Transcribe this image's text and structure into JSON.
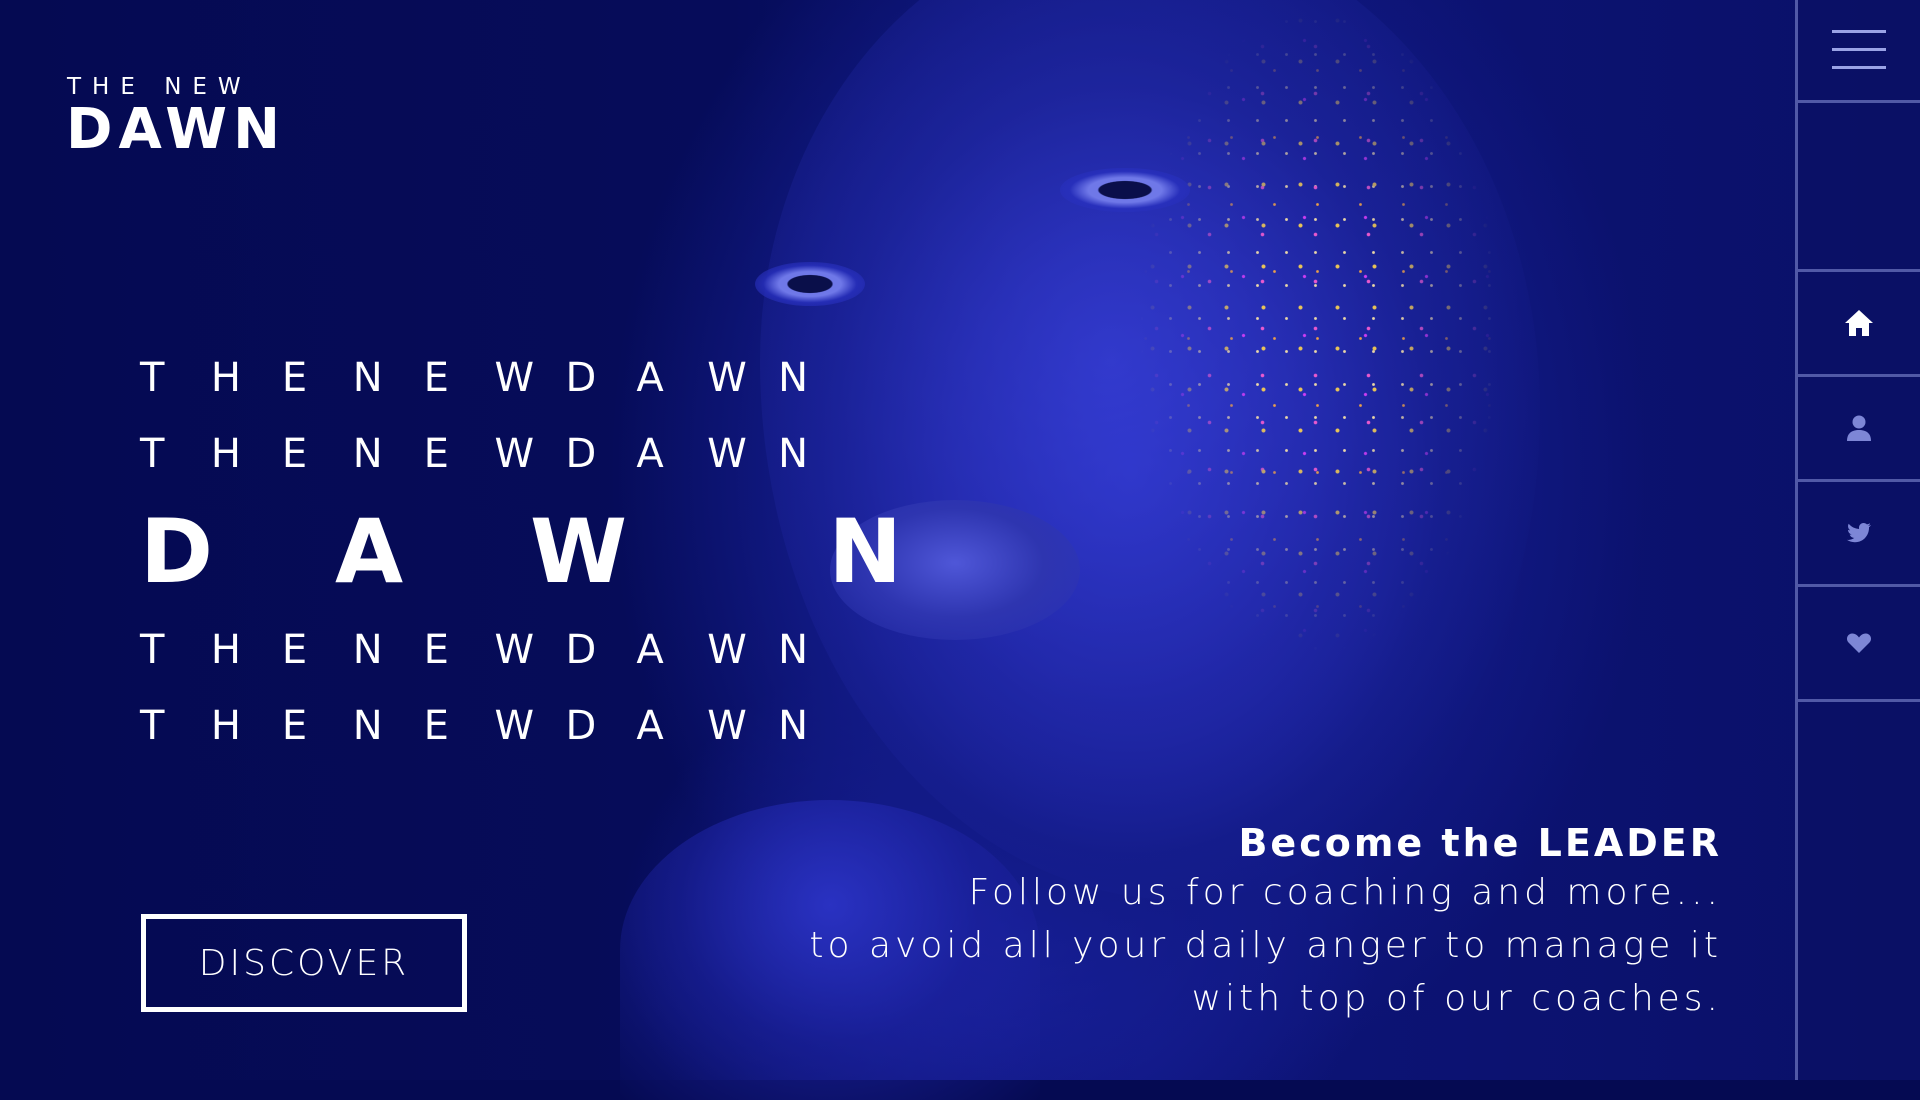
{
  "logo": {
    "top": "THE NEW",
    "main": "DAWN"
  },
  "title": {
    "rows": [
      [
        "T",
        "H",
        "E",
        "",
        "N",
        "E",
        "W",
        "",
        "D",
        "A",
        "W",
        "N"
      ],
      [
        "T",
        "H",
        "E",
        "",
        "N",
        "E",
        "W",
        "",
        "D",
        "A",
        "W",
        "N"
      ],
      [
        "T",
        "H",
        "E",
        "",
        "N",
        "E",
        "W",
        "",
        "D",
        "A",
        "W",
        "N"
      ],
      [
        "T",
        "H",
        "E",
        "",
        "N",
        "E",
        "W",
        "",
        "D",
        "A",
        "W",
        "N"
      ]
    ],
    "big": [
      "D",
      "A",
      "W",
      "N"
    ]
  },
  "discover_label": "DISCOVER",
  "promo": {
    "heading": "Become the LEADER",
    "line1": "Follow us for coaching and more...",
    "line2": "to avoid all your daily anger to manage it",
    "line3": "with top of our coaches."
  },
  "sidebar": {
    "icons": [
      "menu-icon",
      "home-icon",
      "user-icon",
      "twitter-icon",
      "heart-icon"
    ]
  },
  "colors": {
    "background": "#050a52",
    "accent": "#ffffff",
    "sidebar_border": "#8c96dc"
  }
}
